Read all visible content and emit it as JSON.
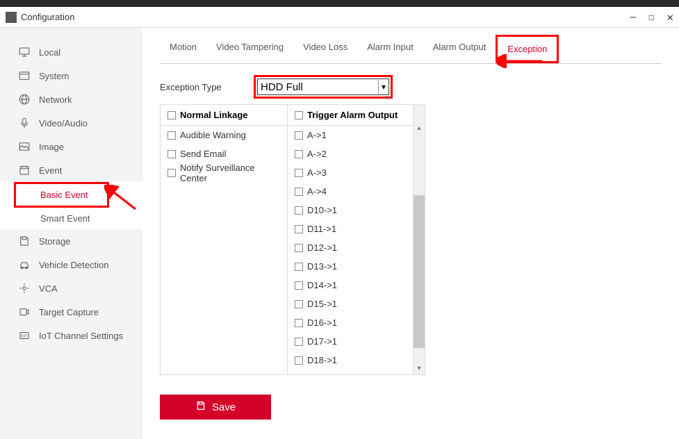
{
  "window": {
    "title": "Configuration"
  },
  "sidebar": {
    "items": [
      {
        "label": "Local",
        "icon": "monitor"
      },
      {
        "label": "System",
        "icon": "system"
      },
      {
        "label": "Network",
        "icon": "globe"
      },
      {
        "label": "Video/Audio",
        "icon": "mic"
      },
      {
        "label": "Image",
        "icon": "image"
      },
      {
        "label": "Event",
        "icon": "calendar"
      },
      {
        "label": "Storage",
        "icon": "save"
      },
      {
        "label": "Vehicle Detection",
        "icon": "car"
      },
      {
        "label": "VCA",
        "icon": "vca"
      },
      {
        "label": "Target Capture",
        "icon": "target"
      },
      {
        "label": "IoT Channel Settings",
        "icon": "iot"
      }
    ],
    "sub": {
      "basic": "Basic Event",
      "smart": "Smart Event"
    }
  },
  "tabs": {
    "motion": "Motion",
    "tampering": "Video Tampering",
    "loss": "Video Loss",
    "alarmIn": "Alarm Input",
    "alarmOut": "Alarm Output",
    "exception": "Exception"
  },
  "form": {
    "exceptionTypeLabel": "Exception Type",
    "exceptionTypeValue": "HDD Full"
  },
  "linkage": {
    "normalHeader": "Normal Linkage",
    "triggerHeader": "Trigger Alarm Output",
    "normal": [
      "Audible Warning",
      "Send Email",
      "Notify Surveillance Center"
    ],
    "trigger": [
      "A->1",
      "A->2",
      "A->3",
      "A->4",
      "D10->1",
      "D11->1",
      "D12->1",
      "D13->1",
      "D14->1",
      "D15->1",
      "D16->1",
      "D17->1",
      "D18->1"
    ]
  },
  "buttons": {
    "save": "Save"
  }
}
